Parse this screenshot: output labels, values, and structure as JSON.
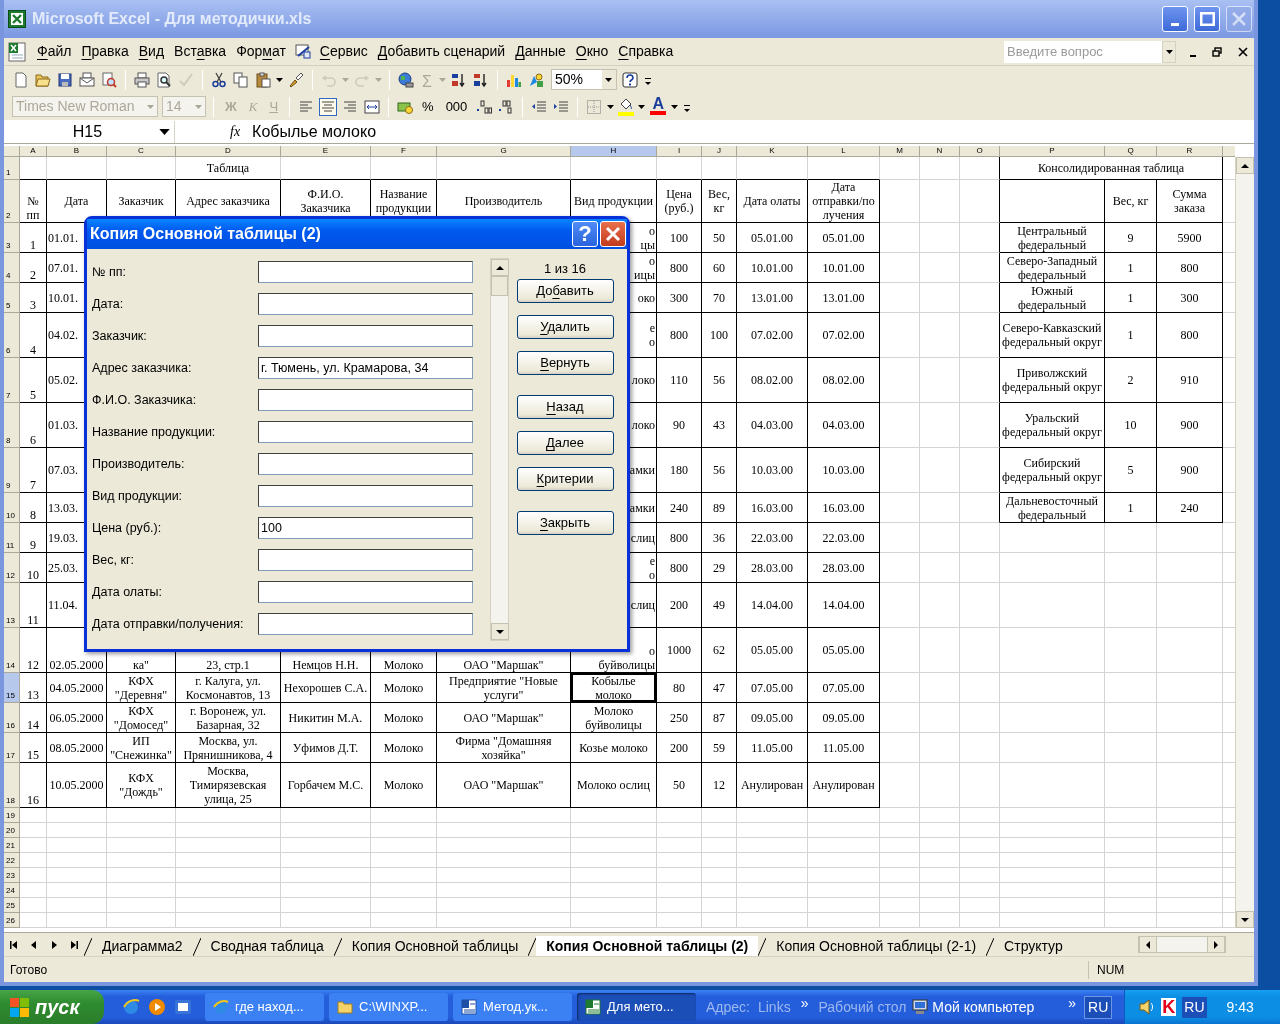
{
  "window": {
    "title": "Microsoft Excel - Для методички.xls",
    "buttons": [
      {
        "kind": "minimize",
        "disabled": false
      },
      {
        "kind": "maximize",
        "disabled": false
      },
      {
        "kind": "close",
        "disabled": true
      }
    ]
  },
  "menu": [
    {
      "parts": [
        {
          "text": "Ф",
          "accel": true
        },
        {
          "text": "айл",
          "accel": false
        }
      ]
    },
    {
      "parts": [
        {
          "text": "П",
          "accel": true
        },
        {
          "text": "равка",
          "accel": false
        }
      ]
    },
    {
      "parts": [
        {
          "text": "В",
          "accel": true
        },
        {
          "text": "ид",
          "accel": false
        }
      ]
    },
    {
      "parts": [
        {
          "text": "Вст",
          "accel": false
        },
        {
          "text": "а",
          "accel": true
        },
        {
          "text": "вка",
          "accel": false
        }
      ]
    },
    {
      "parts": [
        {
          "text": "Фор",
          "accel": false
        },
        {
          "text": "м",
          "accel": true
        },
        {
          "text": "ат",
          "accel": false
        }
      ]
    },
    {
      "parts": [
        {
          "text": "С",
          "accel": true
        },
        {
          "text": "ервис",
          "accel": false
        }
      ]
    },
    {
      "parts": [
        {
          "text": "Д",
          "accel": true
        },
        {
          "text": "обавить сценарий",
          "accel": false
        }
      ]
    },
    {
      "parts": [
        {
          "text": "Д",
          "accel": true
        },
        {
          "text": "анные",
          "accel": false
        }
      ]
    },
    {
      "parts": [
        {
          "text": "О",
          "accel": true
        },
        {
          "text": "кно",
          "accel": false
        }
      ]
    },
    {
      "parts": [
        {
          "text": "С",
          "accel": true
        },
        {
          "text": "правка",
          "accel": false
        }
      ]
    }
  ],
  "help_box": {
    "placeholder": "Введите вопрос"
  },
  "standard_toolbar": [
    {
      "kind": "new",
      "disabled": false
    },
    {
      "kind": "open",
      "disabled": false
    },
    {
      "kind": "save",
      "disabled": false
    },
    {
      "kind": "mail",
      "disabled": false
    },
    {
      "kind": "research",
      "disabled": false
    },
    {
      "kind": "separator"
    },
    {
      "kind": "print",
      "disabled": false
    },
    {
      "kind": "preview",
      "disabled": false
    },
    {
      "kind": "spelling",
      "disabled": true
    },
    {
      "kind": "separator"
    },
    {
      "kind": "cut",
      "disabled": false
    },
    {
      "kind": "copy",
      "disabled": false
    },
    {
      "kind": "paste",
      "disabled": false
    },
    {
      "kind": "painter",
      "disabled": false
    },
    {
      "kind": "separator"
    },
    {
      "kind": "undo",
      "disabled": true
    },
    {
      "kind": "redo",
      "disabled": true
    },
    {
      "kind": "separator"
    },
    {
      "kind": "hyperlink",
      "disabled": false
    },
    {
      "kind": "autosum",
      "text": "Σ",
      "disabled": true
    },
    {
      "kind": "sort_asc",
      "disabled": false
    },
    {
      "kind": "sort_desc",
      "disabled": false
    },
    {
      "kind": "separator"
    },
    {
      "kind": "chart",
      "disabled": false
    },
    {
      "kind": "drawing",
      "disabled": false
    },
    {
      "kind": "zoom",
      "text": "50%",
      "disabled": false
    },
    {
      "kind": "help",
      "disabled": false
    },
    {
      "kind": "options",
      "disabled": false
    }
  ],
  "formatting_toolbar": [
    {
      "kind": "combo",
      "text": "Times New Roman",
      "disabled": true
    },
    {
      "kind": "combo",
      "text": "14",
      "disabled": true
    },
    {
      "kind": "separator"
    },
    {
      "kind": "bold",
      "text": "Ж",
      "disabled": true
    },
    {
      "kind": "italic",
      "text": "К",
      "disabled": true
    },
    {
      "kind": "underline",
      "text": "Ч",
      "disabled": true
    },
    {
      "kind": "separator"
    },
    {
      "kind": "align_left",
      "selected": false
    },
    {
      "kind": "align_center",
      "selected": true
    },
    {
      "kind": "align_right",
      "selected": false
    },
    {
      "kind": "merge"
    },
    {
      "kind": "separator"
    },
    {
      "kind": "currency"
    },
    {
      "kind": "text",
      "text": "%"
    },
    {
      "kind": "text",
      "text": "000"
    },
    {
      "kind": "increase_decimal"
    },
    {
      "kind": "decrease_decimal"
    },
    {
      "kind": "separator"
    },
    {
      "kind": "outdent"
    },
    {
      "kind": "indent"
    },
    {
      "kind": "separator"
    },
    {
      "kind": "borders"
    },
    {
      "kind": "fill_color",
      "color": "#ffff00"
    },
    {
      "kind": "font_color",
      "text": "A",
      "color": "#ff0000"
    },
    {
      "kind": "options"
    }
  ],
  "formula_bar": {
    "name_box": "H15",
    "fx": "fx",
    "formula": "Кобылье молоко"
  },
  "sheet": {
    "columns": [
      {
        "label": "A",
        "selected": false
      },
      {
        "label": "B",
        "selected": false
      },
      {
        "label": "C",
        "selected": false
      },
      {
        "label": "D",
        "selected": false
      },
      {
        "label": "E",
        "selected": false
      },
      {
        "label": "F",
        "selected": false
      },
      {
        "label": "G",
        "selected": false
      },
      {
        "label": "H",
        "selected": true
      },
      {
        "label": "I",
        "selected": false
      },
      {
        "label": "J",
        "selected": false
      },
      {
        "label": "K",
        "selected": false
      },
      {
        "label": "L",
        "selected": false
      },
      {
        "label": "M",
        "selected": false
      },
      {
        "label": "N",
        "selected": false
      },
      {
        "label": "O",
        "selected": false
      },
      {
        "label": "P",
        "selected": false
      },
      {
        "label": "Q",
        "selected": false
      },
      {
        "label": "R",
        "selected": false
      }
    ],
    "rows": [
      {
        "number": "1",
        "selected": false,
        "cells": {
          "D": "Таблица",
          "P": "Консолидированная таблица"
        }
      },
      {
        "number": "2",
        "selected": false,
        "cells": {
          "A": "№ пп",
          "B": "Дата",
          "C": "Заказчик",
          "D": "Адрес заказчика",
          "E": "Ф.И.О. Заказчика",
          "F": "Название продукции",
          "G": "Производитель",
          "H": "Вид продукции",
          "I": "Цена (руб.)",
          "J": "Вес, кг",
          "K": "Дата олаты",
          "L": "Дата отправки/по лучения",
          "Q": "Вес, кг",
          "R": "Сумма заказа"
        }
      },
      {
        "number": "3",
        "selected": false,
        "cells": {
          "A": "1",
          "B": "01.01.",
          "H": "о\nцы",
          "I": "100",
          "J": "50",
          "K": "05.01.00",
          "L": "05.01.00",
          "P": "Центральный федеральный",
          "Q": "9",
          "R": "5900"
        }
      },
      {
        "number": "4",
        "selected": false,
        "cells": {
          "A": "2",
          "B": "07.01.",
          "H": "о\nицы",
          "I": "800",
          "J": "60",
          "K": "10.01.00",
          "L": "10.01.00",
          "P": "Северо-Западный федеральный",
          "Q": "1",
          "R": "800"
        }
      },
      {
        "number": "5",
        "selected": false,
        "cells": {
          "A": "3",
          "B": "10.01.",
          "H": "око",
          "I": "300",
          "J": "70",
          "K": "13.01.00",
          "L": "13.01.00",
          "P": "Южный федеральный",
          "Q": "1",
          "R": "300"
        }
      },
      {
        "number": "6",
        "selected": false,
        "cells": {
          "A": "4",
          "B": "04.02.",
          "H": "е\nо",
          "I": "800",
          "J": "100",
          "K": "07.02.00",
          "L": "07.02.00",
          "P": "Северо-Кавказский федеральный округ",
          "Q": "1",
          "R": "800"
        }
      },
      {
        "number": "7",
        "selected": false,
        "cells": {
          "A": "5",
          "B": "05.02.",
          "H": "локо",
          "I": "110",
          "J": "56",
          "K": "08.02.00",
          "L": "08.02.00",
          "P": "Приволжский федеральный округ",
          "Q": "2",
          "R": "910"
        }
      },
      {
        "number": "8",
        "selected": false,
        "cells": {
          "A": "6",
          "B": "01.03.",
          "H": "локо",
          "I": "90",
          "J": "43",
          "K": "04.03.00",
          "L": "04.03.00",
          "P": "Уральский федеральный округ",
          "Q": "10",
          "R": "900"
        }
      },
      {
        "number": "9",
        "selected": false,
        "cells": {
          "A": "7",
          "B": "07.03.",
          "H": "амки",
          "I": "180",
          "J": "56",
          "K": "10.03.00",
          "L": "10.03.00",
          "P": "Сибирский федеральный округ",
          "Q": "5",
          "R": "900"
        }
      },
      {
        "number": "10",
        "selected": false,
        "cells": {
          "A": "8",
          "B": "13.03.",
          "H": "амки",
          "I": "240",
          "J": "89",
          "K": "16.03.00",
          "L": "16.03.00",
          "P": "Дальневосточный федеральный",
          "Q": "1",
          "R": "240"
        }
      },
      {
        "number": "11",
        "selected": false,
        "cells": {
          "A": "9",
          "B": "19.03.",
          "H": "слиц",
          "I": "800",
          "J": "36",
          "K": "22.03.00",
          "L": "22.03.00"
        }
      },
      {
        "number": "12",
        "selected": false,
        "cells": {
          "A": "10",
          "B": "25.03.",
          "H": "е\nо",
          "I": "800",
          "J": "29",
          "K": "28.03.00",
          "L": "28.03.00"
        }
      },
      {
        "number": "13",
        "selected": false,
        "cells": {
          "A": "11",
          "B": "11.04.",
          "H": "слиц",
          "I": "200",
          "J": "49",
          "K": "14.04.00",
          "L": "14.04.00"
        }
      },
      {
        "number": "14",
        "selected": false,
        "cells": {
          "A": "12",
          "B": "02.05.2000",
          "C": "ка\"",
          "D": "23, стр.1",
          "E": "Немцов Н.Н.",
          "F": "Молоко",
          "G": "ОАО \"Маршак\"",
          "H": "о\nбуйволицы",
          "I": "1000",
          "J": "62",
          "K": "05.05.00",
          "L": "05.05.00"
        }
      },
      {
        "number": "15",
        "selected": true,
        "cells": {
          "A": "13",
          "B": "04.05.2000",
          "C": "КФХ \"Деревня\"",
          "D": "г. Калуга, ул. Космонавтов, 13",
          "E": "Нехорошев С.А.",
          "F": "Молоко",
          "G": "Предприятие \"Новые услуги\"",
          "H": "Кобылье молоко",
          "I": "80",
          "J": "47",
          "K": "07.05.00",
          "L": "07.05.00"
        }
      },
      {
        "number": "16",
        "selected": false,
        "cells": {
          "A": "14",
          "B": "06.05.2000",
          "C": "КФХ \"Домосед\"",
          "D": "г. Воронеж, ул. Базарная, 32",
          "E": "Никитин М.А.",
          "F": "Молоко",
          "G": "ОАО \"Маршак\"",
          "H": "Молоко буйволицы",
          "I": "250",
          "J": "87",
          "K": "09.05.00",
          "L": "09.05.00"
        }
      },
      {
        "number": "17",
        "selected": false,
        "cells": {
          "A": "15",
          "B": "08.05.2000",
          "C": "ИП \"Снежинка\"",
          "D": "Москва, ул. Прянишникова, 4",
          "E": "Уфимов Д.Т.",
          "F": "Молоко",
          "G": "Фирма \"Домашняя хозяйка\"",
          "H": "Козье молоко",
          "I": "200",
          "J": "59",
          "K": "11.05.00",
          "L": "11.05.00"
        }
      },
      {
        "number": "18",
        "selected": false,
        "cells": {
          "A": "16",
          "B": "10.05.2000",
          "C": "КФХ \"Дождь\"",
          "D": "Москва, Тимирязевская улица, 25",
          "E": "Горбачем М.С.",
          "F": "Молоко",
          "G": "ОАО \"Маршак\"",
          "H": "Молоко ослиц",
          "I": "50",
          "J": "12",
          "K": "Анулирован",
          "L": "Анулирован"
        }
      },
      {
        "number": "19",
        "selected": false
      },
      {
        "number": "20",
        "selected": false
      },
      {
        "number": "21",
        "selected": false
      },
      {
        "number": "22",
        "selected": false
      },
      {
        "number": "23",
        "selected": false
      },
      {
        "number": "24",
        "selected": false
      },
      {
        "number": "25",
        "selected": false
      },
      {
        "number": "26",
        "selected": false
      }
    ]
  },
  "dialog": {
    "title": "Копия Основной таблицы (2)",
    "help": "?",
    "fields": [
      {
        "label": "№ пп:"
      },
      {
        "label": "Дата:"
      },
      {
        "label": "Заказчик:"
      },
      {
        "label": "Адрес заказчика:",
        "value": "г. Тюмень, ул. Крамарова, 34"
      },
      {
        "label": "Ф.И.О. Заказчика:"
      },
      {
        "label": "Название продукции:"
      },
      {
        "label": "Производитель:"
      },
      {
        "label": "Вид продукции:"
      },
      {
        "label": "Цена (руб.):",
        "value": "100"
      },
      {
        "label": "Вес, кг:"
      },
      {
        "label": "Дата олаты:"
      },
      {
        "label": "Дата отправки/получения:"
      }
    ],
    "record": "1 из 16",
    "button_groups": [
      [
        {
          "parts": [
            {
              "text": "До",
              "accel": false
            },
            {
              "text": "б",
              "accel": true
            },
            {
              "text": "авить",
              "accel": false
            }
          ]
        },
        {
          "parts": [
            {
              "text": "У",
              "accel": true
            },
            {
              "text": "далить",
              "accel": false
            }
          ]
        },
        {
          "parts": [
            {
              "text": "В",
              "accel": true
            },
            {
              "text": "ернуть",
              "accel": false
            }
          ]
        }
      ],
      [
        {
          "parts": [
            {
              "text": "Н",
              "accel": true
            },
            {
              "text": "азад",
              "accel": false
            }
          ]
        },
        {
          "parts": [
            {
              "text": "Д",
              "accel": true
            },
            {
              "text": "алее",
              "accel": false
            }
          ]
        },
        {
          "parts": [
            {
              "text": "К",
              "accel": true
            },
            {
              "text": "ритерии",
              "accel": false
            }
          ]
        }
      ],
      [
        {
          "parts": [
            {
              "text": "З",
              "accel": true
            },
            {
              "text": "акрыть",
              "accel": false
            }
          ]
        }
      ]
    ]
  },
  "sheet_tabs": [
    {
      "label": "Диаграмма2",
      "selected": false
    },
    {
      "label": "Сводная таблица",
      "selected": false
    },
    {
      "label": "Копия Основной таблицы",
      "selected": false
    },
    {
      "label": "Копия Основной таблицы (2)",
      "selected": true
    },
    {
      "label": "Копия Основной таблицы (2-1)",
      "selected": false
    },
    {
      "label": "Структур",
      "selected": false
    }
  ],
  "status_bar": {
    "text": "Готово",
    "indicator": "NUM"
  },
  "taskbar": {
    "start": "пуск",
    "tasks": [
      {
        "kind": "browser",
        "label": "где наход...",
        "selected": false
      },
      {
        "kind": "folder",
        "label": "C:\\WINXP...",
        "selected": false
      },
      {
        "kind": "word",
        "label": "Метод.ук...",
        "selected": false
      },
      {
        "kind": "excel",
        "label": "Для мето...",
        "selected": true
      }
    ],
    "address": "Адрес:",
    "links": "Links",
    "chevron_links": "»",
    "desktop": "Рабочий стол",
    "my_computer": "Мой компьютер",
    "chevron_toolbar": "»",
    "language_bar": "RU",
    "tray": {
      "antivirus": "K",
      "language": "RU",
      "clock": "9:43"
    }
  }
}
